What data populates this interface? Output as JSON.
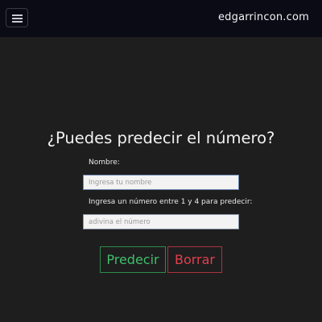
{
  "navbar": {
    "brand": "edgarrincon.com",
    "menu_icon": "hamburger-menu-icon"
  },
  "main": {
    "title": "¿Puedes predecir el número?",
    "name_label": "Nombre:",
    "name_placeholder": "Ingresa tu nombre",
    "name_value": "",
    "number_label": "Ingresa un número entre 1 y 4 para predecir:",
    "number_placeholder": "adivina el número",
    "number_value": "",
    "predict_label": "Predecir",
    "clear_label": "Borrar"
  },
  "colors": {
    "navbar_bg": "#0b0b16",
    "page_bg": "#1e1e1e",
    "predict": "#3fbf6b",
    "clear": "#e0404f"
  }
}
